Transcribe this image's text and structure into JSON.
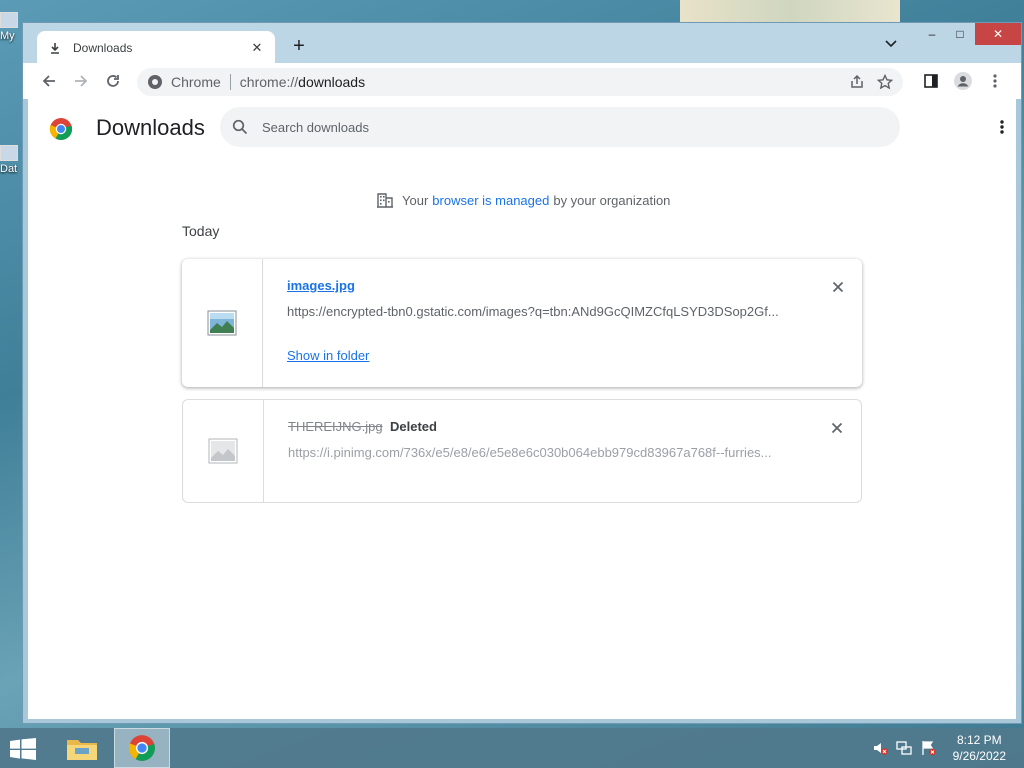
{
  "desktop": {
    "icons": [
      {
        "label": "My"
      },
      {
        "label": "Dat"
      }
    ]
  },
  "tab": {
    "title": "Downloads",
    "close_label": "✕"
  },
  "new_tab_label": "+",
  "window_controls": {
    "minimize": "–",
    "maximize": "□",
    "close": "✕"
  },
  "address_bar": {
    "site_label": "Chrome",
    "url_scheme": "chrome://",
    "url_host": "downloads"
  },
  "page": {
    "title": "Downloads",
    "search_placeholder": "Search downloads",
    "managed_notice": {
      "prefix": "Your",
      "link": "browser is managed",
      "suffix": "by your organization"
    },
    "date_header": "Today",
    "downloads": [
      {
        "filename": "images.jpg",
        "url": "https://encrypted-tbn0.gstatic.com/images?q=tbn:ANd9GcQIMZCfqLSYD3DSop2Gf...",
        "action": "Show in folder",
        "status": ""
      },
      {
        "filename": "THEREIJNG.jpg",
        "url": "https://i.pinimg.com/736x/e5/e8/e6/e5e8e6c030b064ebb979cd83967a768f--furries...",
        "action": "",
        "status": "Deleted"
      }
    ]
  },
  "taskbar": {
    "clock_time": "8:12 PM",
    "clock_date": "9/26/2022"
  },
  "colors": {
    "link": "#1a73e8",
    "close_button": "#c74545"
  }
}
